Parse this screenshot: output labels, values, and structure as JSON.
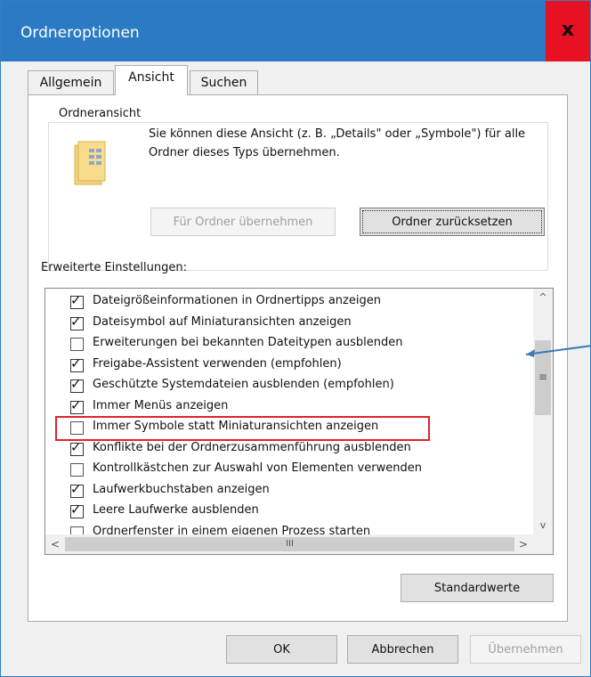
{
  "window": {
    "title": "Ordneroptionen",
    "close_label": "x"
  },
  "tabs": [
    {
      "label": "Allgemein"
    },
    {
      "label": "Ansicht"
    },
    {
      "label": "Suchen"
    }
  ],
  "folder_view": {
    "group_title": "Ordneransicht",
    "description": "Sie können diese Ansicht (z. B. „Details\" oder „Symbole\") für alle Ordner dieses Typs übernehmen.",
    "apply_label": "Für Ordner übernehmen",
    "reset_label": "Ordner zurücksetzen"
  },
  "advanced": {
    "label": "Erweiterte Einstellungen:",
    "items": [
      {
        "label": "Dateigrößeinformationen in Ordnertipps anzeigen",
        "checked": true
      },
      {
        "label": "Dateisymbol auf Miniaturansichten anzeigen",
        "checked": true
      },
      {
        "label": "Erweiterungen bei bekannten Dateitypen ausblenden",
        "checked": false
      },
      {
        "label": "Freigabe-Assistent verwenden (empfohlen)",
        "checked": true
      },
      {
        "label": "Geschützte Systemdateien ausblenden (empfohlen)",
        "checked": true
      },
      {
        "label": "Immer Menüs anzeigen",
        "checked": true
      },
      {
        "label": "Immer Symbole statt Miniaturansichten anzeigen",
        "checked": false
      },
      {
        "label": "Konflikte bei der Ordnerzusammenführung ausblenden",
        "checked": true
      },
      {
        "label": "Kontrollkästchen zur Auswahl von Elementen verwenden",
        "checked": false
      },
      {
        "label": "Laufwerkbuchstaben anzeigen",
        "checked": true
      },
      {
        "label": "Leere Laufwerke ausblenden",
        "checked": true
      },
      {
        "label": "Ordnerfenster in einem eigenen Prozess starten",
        "checked": false
      }
    ],
    "scroll_up": "^",
    "scroll_down": "v",
    "scroll_left": "<",
    "scroll_right": ">",
    "hscroll_grip": "III",
    "vscroll_grip": "≡",
    "highlight_color": "#e0232b"
  },
  "buttons": {
    "defaults_label": "Standardwerte",
    "ok_label": "OK",
    "cancel_label": "Abbrechen",
    "apply_label": "Übernehmen"
  },
  "colors": {
    "titlebar": "#2b7bc4",
    "close": "#e81123",
    "annotation_arrow": "#3b78b8"
  }
}
